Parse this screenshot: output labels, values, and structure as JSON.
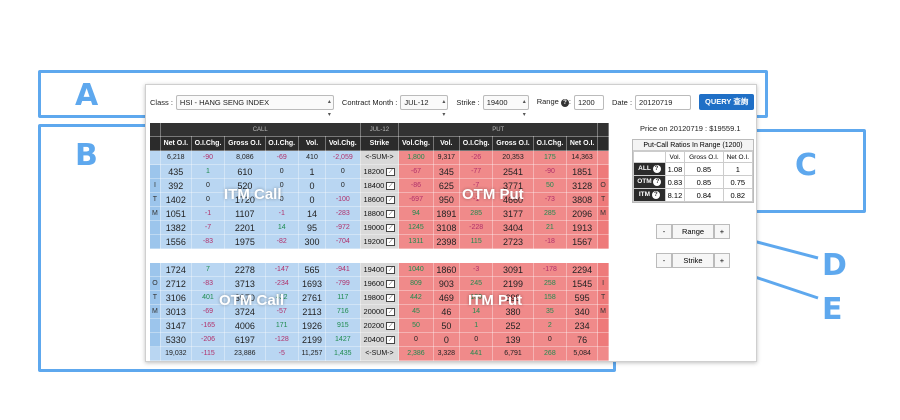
{
  "callouts": {
    "a": "A",
    "b": "B",
    "c": "C",
    "d": "D",
    "e": "E"
  },
  "toolbar": {
    "class_label": "Class :",
    "class_value": "HSI - HANG SENG INDEX",
    "month_label": "Contract Month :",
    "month_value": "JUL-12",
    "strike_label": "Strike :",
    "strike_value": "19400",
    "range_label": "Range",
    "range_value": "1200",
    "date_label": "Date :",
    "date_value": "20120719",
    "query_label": "QUERY 查詢",
    "help_glyph": "?"
  },
  "table": {
    "band": {
      "call": "CALL",
      "mid": "JUL-12",
      "put": "PUT"
    },
    "headers": {
      "call": [
        "Net O.I.",
        "O.I.Chg.",
        "Gross O.I.",
        "O.I.Chg.",
        "Vol.",
        "Vol.Chg."
      ],
      "strike": "Strike",
      "put": [
        "Vol.Chg.",
        "Vol.",
        "O.I.Chg.",
        "Gross O.I.",
        "O.I.Chg.",
        "Net O.I."
      ]
    },
    "top_sum": {
      "call": [
        "6,218",
        "-90",
        "8,086",
        "-69",
        "410",
        "-2,059"
      ],
      "strike": "<-SUM->",
      "put": [
        "1,800",
        "9,317",
        "-26",
        "20,353",
        "175",
        "14,363"
      ]
    },
    "itm_call_rows": [
      {
        "strike": "18200",
        "call": [
          "435",
          "1",
          "610",
          "0",
          "1",
          "0"
        ],
        "put": [
          "-67",
          "345",
          "-77",
          "2541",
          "-90",
          "1851"
        ]
      },
      {
        "strike": "18400",
        "call": [
          "392",
          "0",
          "520",
          "0",
          "0",
          "0"
        ],
        "put": [
          "-86",
          "625",
          "-7",
          "3771",
          "50",
          "3128"
        ]
      },
      {
        "strike": "18600",
        "call": [
          "1402",
          "0",
          "1720",
          "0",
          "0",
          "-100"
        ],
        "put": [
          "-697",
          "950",
          "-1",
          "4660",
          "-73",
          "3808"
        ]
      },
      {
        "strike": "18800",
        "call": [
          "1051",
          "-1",
          "1107",
          "-1",
          "14",
          "-283"
        ],
        "put": [
          "94",
          "1891",
          "285",
          "3177",
          "285",
          "2096"
        ]
      },
      {
        "strike": "19000",
        "call": [
          "1382",
          "-7",
          "2201",
          "14",
          "95",
          "-972"
        ],
        "put": [
          "1245",
          "3108",
          "-228",
          "3404",
          "21",
          "1913"
        ]
      },
      {
        "strike": "19200",
        "call": [
          "1556",
          "-83",
          "1975",
          "-82",
          "300",
          "-704"
        ],
        "put": [
          "1311",
          "2398",
          "115",
          "2723",
          "-18",
          "1567"
        ]
      }
    ],
    "otm_call_rows": [
      {
        "strike": "19400",
        "call": [
          "1724",
          "7",
          "2278",
          "-147",
          "565",
          "-941"
        ],
        "put": [
          "1040",
          "1860",
          "-3",
          "3091",
          "-178",
          "2294"
        ]
      },
      {
        "strike": "19600",
        "call": [
          "2712",
          "-83",
          "3713",
          "-234",
          "1693",
          "-799"
        ],
        "put": [
          "809",
          "903",
          "245",
          "2199",
          "258",
          "1545"
        ]
      },
      {
        "strike": "19800",
        "call": [
          "3106",
          "401",
          "3970",
          "422",
          "2761",
          "117"
        ],
        "put": [
          "442",
          "469",
          "180",
          "699",
          "158",
          "595"
        ]
      },
      {
        "strike": "20000",
        "call": [
          "3013",
          "-69",
          "3724",
          "-57",
          "2113",
          "716"
        ],
        "put": [
          "45",
          "46",
          "14",
          "380",
          "35",
          "340"
        ]
      },
      {
        "strike": "20200",
        "call": [
          "3147",
          "-165",
          "4006",
          "171",
          "1926",
          "915"
        ],
        "put": [
          "50",
          "50",
          "1",
          "252",
          "2",
          "234"
        ]
      },
      {
        "strike": "20400",
        "call": [
          "5330",
          "-206",
          "6197",
          "-128",
          "2199",
          "1427"
        ],
        "put": [
          "0",
          "0",
          "0",
          "139",
          "0",
          "76"
        ]
      }
    ],
    "bottom_sum": {
      "call": [
        "19,032",
        "-115",
        "23,886",
        "-5",
        "11,257",
        "1,435"
      ],
      "strike": "<-SUM->",
      "put": [
        "2,386",
        "3,328",
        "441",
        "6,791",
        "268",
        "5,084"
      ]
    },
    "side_top_left": [
      "I",
      "T",
      "M"
    ],
    "side_bottom_left": [
      "O",
      "T",
      "M"
    ],
    "side_top_right": [
      "O",
      "T",
      "M"
    ],
    "side_bottom_right": [
      "I",
      "T",
      "M"
    ],
    "overlays": {
      "itm_call": "ITM Call",
      "otm_put": "OTM Put",
      "otm_call": "OTM Call",
      "itm_put": "ITM Put"
    }
  },
  "price": "Price on 20120719 : $19559.1",
  "ratios": {
    "title": "Put-Call Ratios In Range (1200)",
    "headers": [
      "Vol.",
      "Gross O.I.",
      "Net O.I."
    ],
    "rows": [
      {
        "label": "ALL",
        "values": [
          "1.08",
          "0.85",
          "1"
        ]
      },
      {
        "label": "OTM",
        "values": [
          "0.83",
          "0.85",
          "0.75"
        ]
      },
      {
        "label": "ITM",
        "values": [
          "8.12",
          "0.84",
          "0.82"
        ]
      }
    ]
  },
  "range_stepper": {
    "minus": "-",
    "label": "Range",
    "plus": "+"
  },
  "strike_stepper": {
    "minus": "-",
    "label": "Strike",
    "plus": "+"
  },
  "colors": {
    "accent": "#5ea8ee",
    "call": "#b9d6f2",
    "put": "#f08a8a",
    "query": "#1f6fc6"
  }
}
